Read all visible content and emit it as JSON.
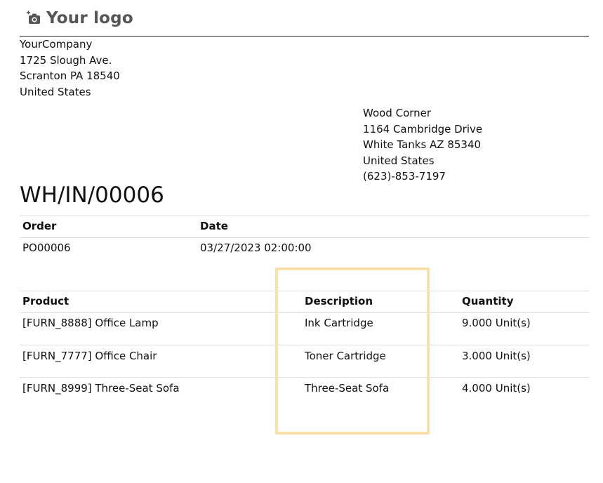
{
  "logo": {
    "text": "Your logo",
    "icon": "camera-icon"
  },
  "company": [
    "YourCompany",
    "1725 Slough Ave.",
    "Scranton PA 18540",
    "United States"
  ],
  "customer": [
    "Wood Corner",
    "1164 Cambridge Drive",
    "White Tanks AZ 85340",
    "United States",
    "(623)-853-7197"
  ],
  "title": "WH/IN/00006",
  "info_table": {
    "headers": {
      "order": "Order",
      "date": "Date"
    },
    "row": {
      "order": "PO00006",
      "date": "03/27/2023 02:00:00"
    }
  },
  "lines_table": {
    "headers": {
      "product": "Product",
      "description": "Description",
      "quantity": "Quantity"
    },
    "rows": [
      {
        "product": "[FURN_8888] Office Lamp",
        "description": "Ink Cartridge",
        "quantity": "9.000 Unit(s)"
      },
      {
        "product": "[FURN_7777] Office Chair",
        "description": "Toner Cartridge",
        "quantity": "3.000 Unit(s)"
      },
      {
        "product": "[FURN_8999] Three-Seat Sofa",
        "description": "Three-Seat Sofa",
        "quantity": "4.000 Unit(s)"
      }
    ]
  },
  "colors": {
    "highlight": "#fae1a9",
    "logo_text": "#555555",
    "rule": "#dddddd"
  }
}
